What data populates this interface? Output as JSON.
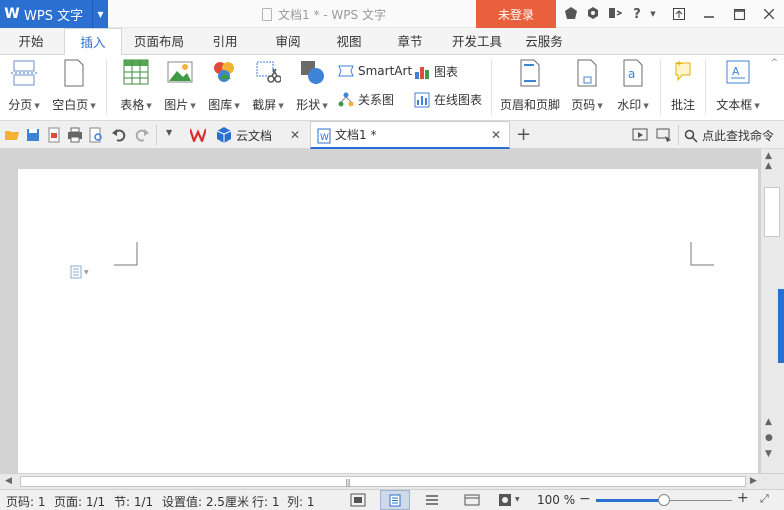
{
  "titlebar": {
    "app_name": "WPS 文字",
    "window_title": "文档1 * - WPS 文字",
    "login_label": "未登录"
  },
  "menu": {
    "tabs": [
      "开始",
      "插入",
      "页面布局",
      "引用",
      "审阅",
      "视图",
      "章节",
      "开发工具",
      "云服务"
    ],
    "active_tab": "插入"
  },
  "ribbon": {
    "page_break": "分页",
    "blank_page": "空白页",
    "table": "表格",
    "picture": "图片",
    "gallery": "图库",
    "screenshot": "截屏",
    "shape": "形状",
    "smartart": "SmartArt",
    "chart": "图表",
    "relation_chart": "关系图",
    "online_chart": "在线图表",
    "header_footer": "页眉和页脚",
    "page_number": "页码",
    "watermark": "水印",
    "comment": "批注",
    "textbox": "文本框"
  },
  "quickbar": {
    "tab_wps_label": "",
    "tab_cloud_label": "云文档",
    "tab_doc_label": "文档1 *",
    "search_label": "点此查找命令"
  },
  "statusbar": {
    "page_num": "页码: 1",
    "pages": "页面: 1/1",
    "section": "节: 1/1",
    "setting": "设置值: 2.5厘米",
    "row": "行: 1",
    "col": "列: 1",
    "zoom": "100 %"
  },
  "colors": {
    "accent": "#2b6fd0",
    "login": "#e8603c",
    "wps_red": "#d9302a"
  }
}
